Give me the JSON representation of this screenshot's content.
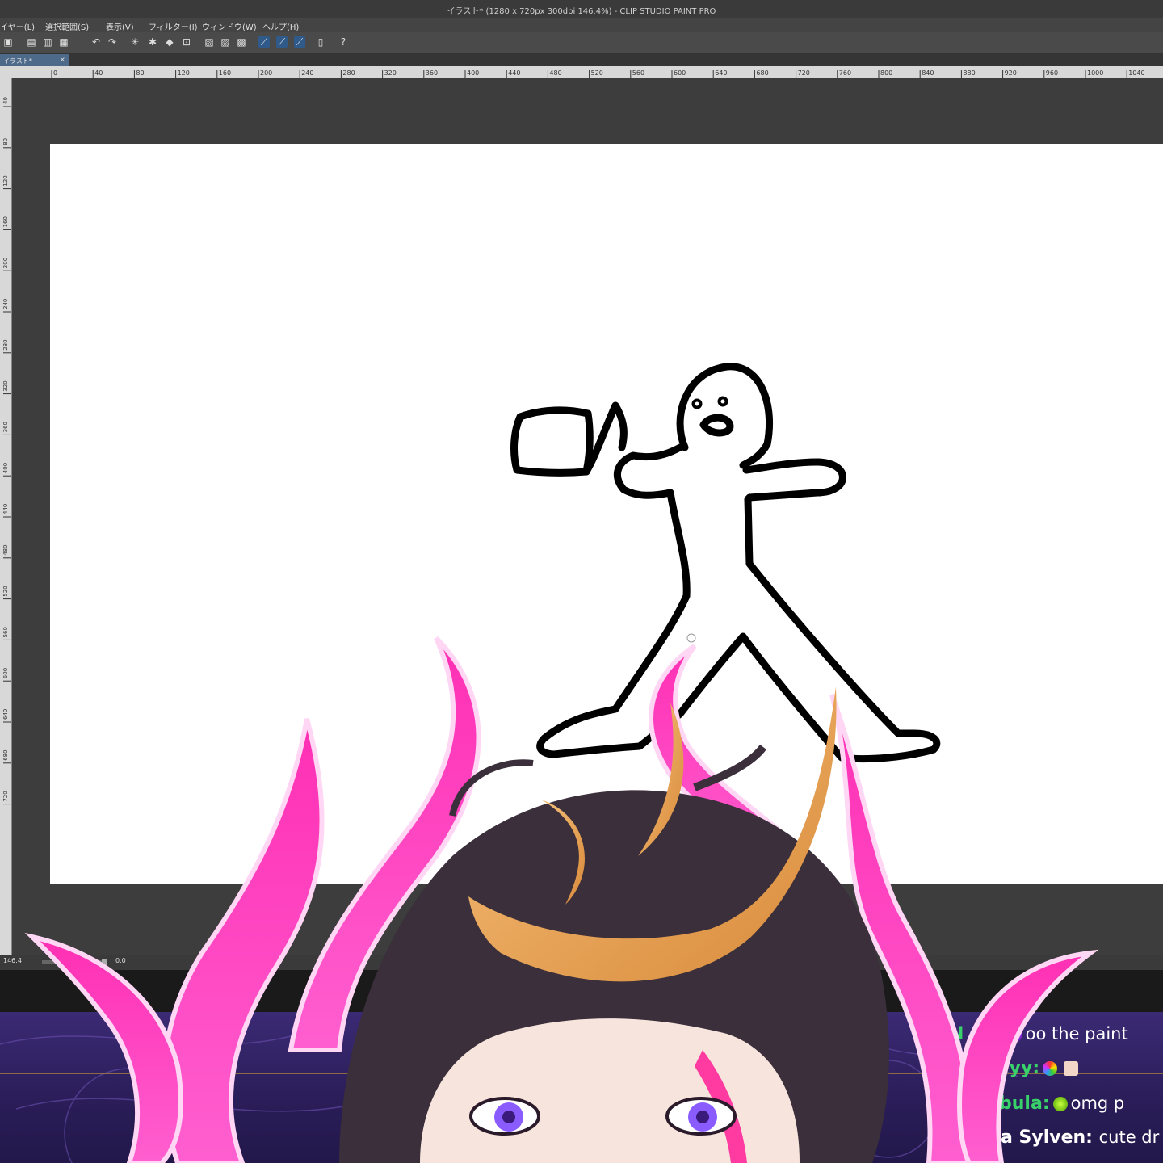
{
  "app": {
    "window_title": "イラスト* (1280 x 720px 300dpi 146.4%)  - CLIP STUDIO PAINT PRO"
  },
  "menubar": {
    "items": [
      "イヤー(L)",
      "選択範囲(S)",
      "表示(V)",
      "フィルター(I)",
      "ウィンドウ(W)",
      "ヘルプ(H)"
    ]
  },
  "toolbar": {
    "icons": [
      "new-file-icon",
      "open-icon",
      "save-icon",
      "undo-icon",
      "redo-icon",
      "loading-icon",
      "fill-icon",
      "transform-icon",
      "clear-selection-icon",
      "snap-ruler-icon",
      "snap-special-ruler-icon",
      "snap-grid-icon",
      "settings-icon",
      "help-icon"
    ]
  },
  "document_tab": {
    "label": "イラスト*",
    "close": "×"
  },
  "ruler": {
    "h_ticks": [
      "0",
      "40",
      "80",
      "120",
      "160",
      "200",
      "240",
      "280",
      "320",
      "360",
      "400",
      "440",
      "480",
      "520",
      "560",
      "600",
      "640",
      "680",
      "720",
      "760",
      "800",
      "840",
      "880",
      "920",
      "960",
      "1000",
      "1040"
    ],
    "v_ticks": [
      "40",
      "80",
      "120",
      "160",
      "200",
      "240",
      "280",
      "320",
      "360",
      "400",
      "440",
      "480",
      "520",
      "560",
      "600",
      "640",
      "680",
      "720"
    ]
  },
  "statusbar": {
    "zoom": "146.4",
    "rotation": "0.0"
  },
  "chat": [
    {
      "user": "N    <3:",
      "message": "oo the paint"
    },
    {
      "user": "Zoeyyyy:",
      "message": ""
    },
    {
      "user": "P   ne bula:",
      "message": "omg p"
    },
    {
      "user": "a Sylven:",
      "message": "cute dr"
    }
  ],
  "colors": {
    "accent": "#ff2fb4",
    "chat_user": "#39d26a",
    "canvas": "#ffffff",
    "stream_bg": "#2a1d58"
  }
}
